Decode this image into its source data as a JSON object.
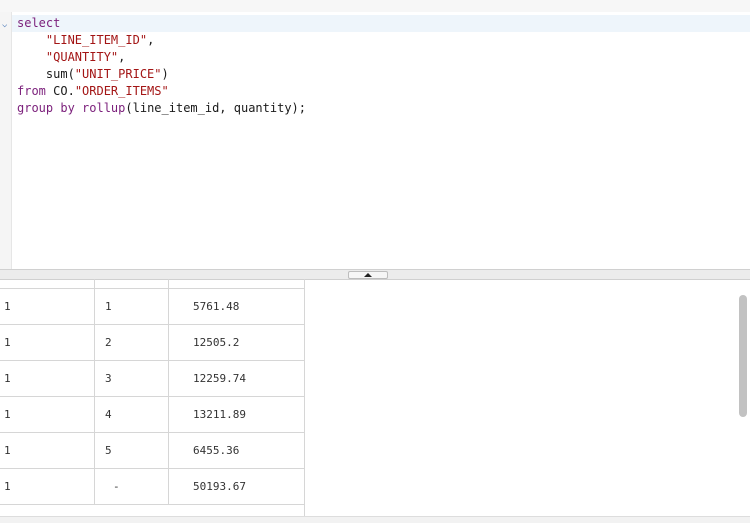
{
  "editor": {
    "fold_icon": "chevron-down-icon",
    "sql_lines": [
      [
        {
          "t": "select",
          "c": "kw"
        }
      ],
      [
        {
          "t": "    ",
          "c": "plain"
        },
        {
          "t": "\"LINE_ITEM_ID\"",
          "c": "str"
        },
        {
          "t": ",",
          "c": "plain"
        }
      ],
      [
        {
          "t": "    ",
          "c": "plain"
        },
        {
          "t": "\"QUANTITY\"",
          "c": "str"
        },
        {
          "t": ",",
          "c": "plain"
        }
      ],
      [
        {
          "t": "    sum(",
          "c": "plain"
        },
        {
          "t": "\"UNIT_PRICE\"",
          "c": "str"
        },
        {
          "t": ")",
          "c": "plain"
        }
      ],
      [
        {
          "t": "from",
          "c": "kw"
        },
        {
          "t": " CO.",
          "c": "plain"
        },
        {
          "t": "\"ORDER_ITEMS\"",
          "c": "str"
        }
      ],
      [
        {
          "t": "group by",
          "c": "kw"
        },
        {
          "t": " ",
          "c": "plain"
        },
        {
          "t": "rollup",
          "c": "kw"
        },
        {
          "t": "(line_item_id, quantity);",
          "c": "plain"
        }
      ]
    ]
  },
  "splitter": {
    "icon": "collapse-up-icon"
  },
  "results": {
    "rows": [
      [
        "1",
        "1",
        "5761.48"
      ],
      [
        "1",
        "2",
        "12505.2"
      ],
      [
        "1",
        "3",
        "12259.74"
      ],
      [
        "1",
        "4",
        "13211.89"
      ],
      [
        "1",
        "5",
        "6455.36"
      ],
      [
        "1",
        "-",
        "50193.67"
      ]
    ]
  }
}
